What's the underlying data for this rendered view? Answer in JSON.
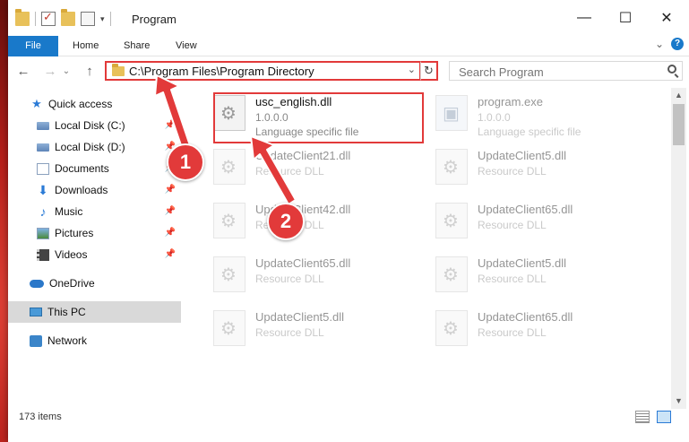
{
  "window": {
    "title": "Program",
    "controls": {
      "minimize": "—",
      "maximize": "☐",
      "close": "✕"
    }
  },
  "ribbon": {
    "tabs": [
      "File",
      "Home",
      "Share",
      "View"
    ],
    "expand": "⌄",
    "help": "?"
  },
  "nav": {
    "back": "←",
    "forward": "→",
    "recent": "⌄",
    "up": "↑",
    "address": "C:\\Program Files\\Program Directory",
    "address_dropdown": "⌄",
    "refresh": "↻",
    "search_placeholder": "Search Program"
  },
  "sidebar": {
    "items": [
      {
        "label": "Quick access",
        "icon": "star-icon",
        "pinned": false
      },
      {
        "label": "Local Disk (C:)",
        "icon": "drive-icon",
        "pinned": true
      },
      {
        "label": "Local Disk (D:)",
        "icon": "drive-icon",
        "pinned": true
      },
      {
        "label": "Documents",
        "icon": "documents-icon",
        "pinned": true
      },
      {
        "label": "Downloads",
        "icon": "downloads-icon",
        "pinned": true
      },
      {
        "label": "Music",
        "icon": "music-icon",
        "pinned": true
      },
      {
        "label": "Pictures",
        "icon": "pictures-icon",
        "pinned": true
      },
      {
        "label": "Videos",
        "icon": "videos-icon",
        "pinned": true
      },
      {
        "label": "OneDrive",
        "icon": "onedrive-icon"
      },
      {
        "label": "This PC",
        "icon": "this-pc-icon",
        "selected": true
      },
      {
        "label": "Network",
        "icon": "network-icon"
      }
    ],
    "pin_glyph": "📌"
  },
  "files": [
    {
      "name": "usc_english.dll",
      "line1": "1.0.0.0",
      "line2": "Language specific file",
      "highlighted": true
    },
    {
      "name": "program.exe",
      "line1": "1.0.0.0",
      "line2": "Language specific file"
    },
    {
      "name": "UpdateClient21.dll",
      "line1": "Resource DLL"
    },
    {
      "name": "UpdateClient5.dll",
      "line1": "Resource DLL"
    },
    {
      "name": "UpdateClient42.dll",
      "line1": "Resource DLL"
    },
    {
      "name": "UpdateClient65.dll",
      "line1": "Resource DLL"
    },
    {
      "name": "UpdateClient65.dll",
      "line1": "Resource DLL"
    },
    {
      "name": "UpdateClient5.dll",
      "line1": "Resource DLL"
    },
    {
      "name": "UpdateClient5.dll",
      "line1": "Resource DLL"
    },
    {
      "name": "UpdateClient65.dll",
      "line1": "Resource DLL"
    }
  ],
  "status": {
    "item_count": "173 items"
  },
  "callouts": [
    "1",
    "2"
  ],
  "colors": {
    "accent": "#1979ca",
    "highlight": "#e23a3a",
    "selected_bg": "#d9d9d9"
  }
}
